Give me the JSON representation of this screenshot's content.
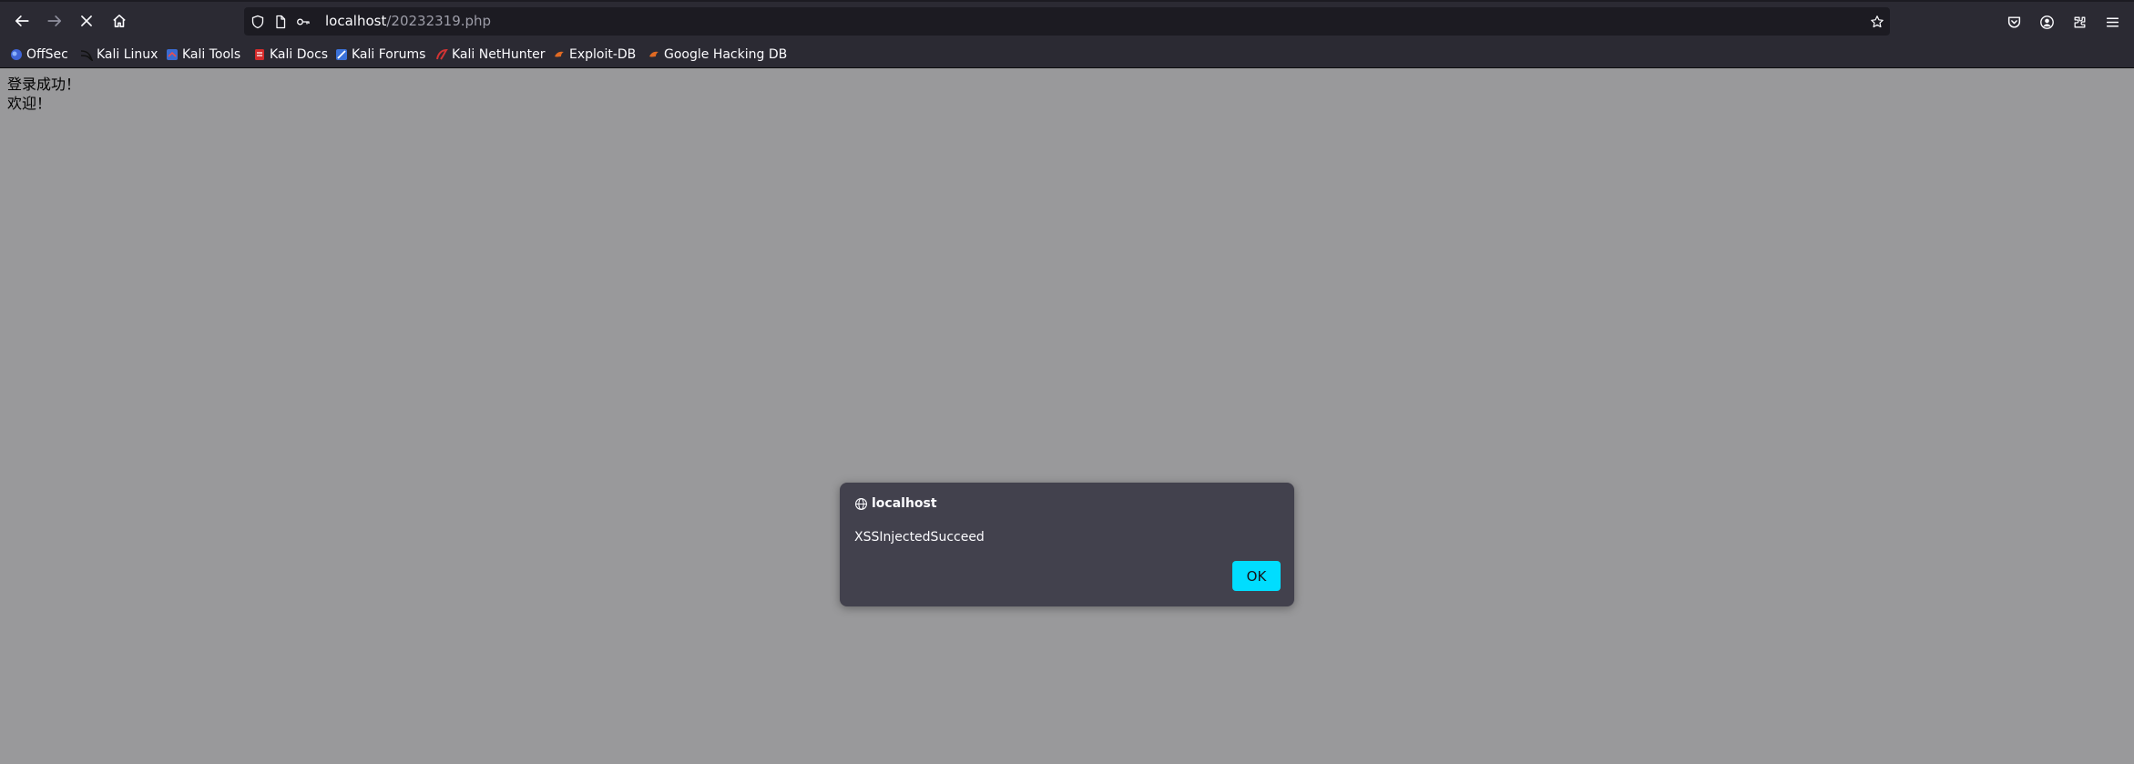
{
  "toolbar": {
    "back_icon": "arrow-left-icon",
    "forward_icon": "arrow-right-icon",
    "stop_icon": "close-icon",
    "home_icon": "home-icon"
  },
  "urlbar": {
    "host": "localhost",
    "path": "/20232319.php",
    "icons": [
      "shield-icon",
      "page-icon",
      "key-icon",
      "star-icon"
    ]
  },
  "right_toolbar": {
    "icons": [
      "pocket-icon",
      "account-icon",
      "extensions-icon",
      "menu-icon"
    ]
  },
  "bookmarks": [
    {
      "label": "OffSec",
      "icon": "offsec-icon",
      "color": "#3f64d6"
    },
    {
      "label": "Kali Linux",
      "icon": "kali-dragon-icon",
      "color": "#2c2c2c"
    },
    {
      "label": "Kali Tools",
      "icon": "kali-tools-icon",
      "color": "#3a6bd1"
    },
    {
      "label": "Kali Docs",
      "icon": "kali-docs-icon",
      "color": "#d62b2b"
    },
    {
      "label": "Kali Forums",
      "icon": "kali-forums-icon",
      "color": "#3b72d9"
    },
    {
      "label": "Kali NetHunter",
      "icon": "nethunter-icon",
      "color": "#d23434"
    },
    {
      "label": "Exploit-DB",
      "icon": "exploit-db-icon",
      "color": "#e06a23"
    },
    {
      "label": "Google Hacking DB",
      "icon": "ghdb-icon",
      "color": "#e06a23"
    }
  ],
  "page": {
    "line1": "登录成功！",
    "line2": "欢迎！"
  },
  "dialog": {
    "origin": "localhost",
    "message": "XSSInjectedSucceed",
    "ok_label": "OK",
    "ok_color": "#00ddff"
  }
}
